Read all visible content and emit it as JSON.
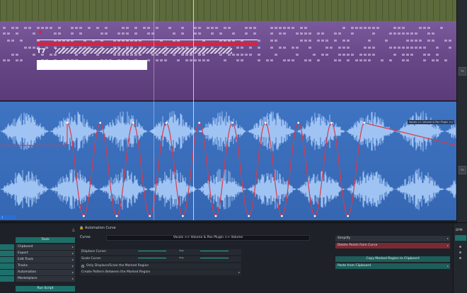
{
  "tracks": {
    "midi_clip_label": "T7",
    "automation_tag": "Vocals >> Volume & Pan Plugin >> Volume",
    "time_tag": "1",
    "side_buttons": [
      "Ve",
      "Ve"
    ]
  },
  "sidebar": {
    "header": "Tools",
    "items": [
      {
        "label": "Clipboard",
        "has_submenu": true
      },
      {
        "label": "Export",
        "has_submenu": true
      },
      {
        "label": "Edit Track",
        "has_submenu": true
      },
      {
        "label": "Tracks",
        "has_submenu": true
      },
      {
        "label": "Automation",
        "has_submenu": true
      },
      {
        "label": "Marketplace",
        "has_submenu": true
      }
    ],
    "run_script": "Run Script",
    "user_icon": "user-icon"
  },
  "automation_panel": {
    "title": "Automation Curve",
    "curve_label": "Curve:",
    "curve_value": "Vocals >> Volume & Pan Plugin >> Volume",
    "displace_label": "Displace Curve:",
    "displace_value": "Avg",
    "scale_label": "Scale Curve:",
    "scale_value": "Avg",
    "only_marked_label": "Only Displace/Scale the Marked Region",
    "pattern_label": "Create Pattern Between the Marked Region"
  },
  "right_panel": {
    "simplify": "Simplify",
    "delete_points": "Delete Points from Curve",
    "copy_region": "Copy Marked Region to Clipboard",
    "paste_clipboard": "Paste from Clipboard"
  },
  "bpm": {
    "label": "BPM"
  },
  "colors": {
    "midi_track": "#6a4a8a",
    "audio_track": "#3b6cb8",
    "automation_curve": "#d9394a",
    "accent_teal": "#1d6f6a",
    "delete_red": "#7a2a33"
  }
}
